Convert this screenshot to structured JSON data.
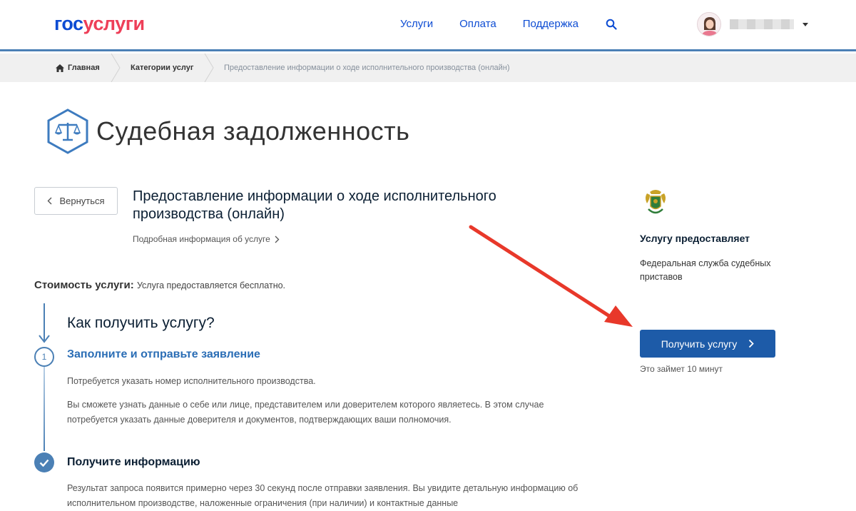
{
  "header": {
    "logo_gos": "гос",
    "logo_uslugi": "услуги",
    "nav": [
      "Услуги",
      "Оплата",
      "Поддержка"
    ],
    "search_icon": "search-icon"
  },
  "breadcrumb": {
    "home": "Главная",
    "categories": "Категории услуг",
    "current": "Предоставление информации о ходе исполнительного производства (онлайн)"
  },
  "page": {
    "title": "Судебная задолженность",
    "back_label": "Вернуться",
    "service_title": "Предоставление информации о ходе исполнительного производства (онлайн)",
    "details_link": "Подробная информация об услуге",
    "cost_label": "Стоимость услуги:",
    "cost_value": "Услуга предоставляется бесплатно.",
    "how_title": "Как получить услугу?",
    "step1_number": "1",
    "step1_title": "Заполните и отправьте заявление",
    "step1_p1": "Потребуется указать номер исполнительного производства.",
    "step1_p2": "Вы сможете узнать данные о себе или лице, представителем или доверителем которого являетесь. В этом случае потребуется указать данные доверителя и документов, подтверждающих ваши полномочия.",
    "step2_title": "Получите информацию",
    "step2_p": "Результат запроса появится примерно через 30 секунд после отправки заявления. Вы увидите детальную информацию об исполнительном производстве, наложенные ограничения (при наличии) и контактные данные"
  },
  "sidebar": {
    "provider_label": "Услугу предоставляет",
    "provider_name": "Федеральная служба судебных приставов",
    "button_label": "Получить услугу",
    "duration": "Это займет 10 минут"
  },
  "colors": {
    "brand_blue": "#0d4cd3",
    "brand_red": "#ee3f58",
    "button_blue": "#1d5ba8",
    "annotation_arrow": "#e8382a"
  }
}
